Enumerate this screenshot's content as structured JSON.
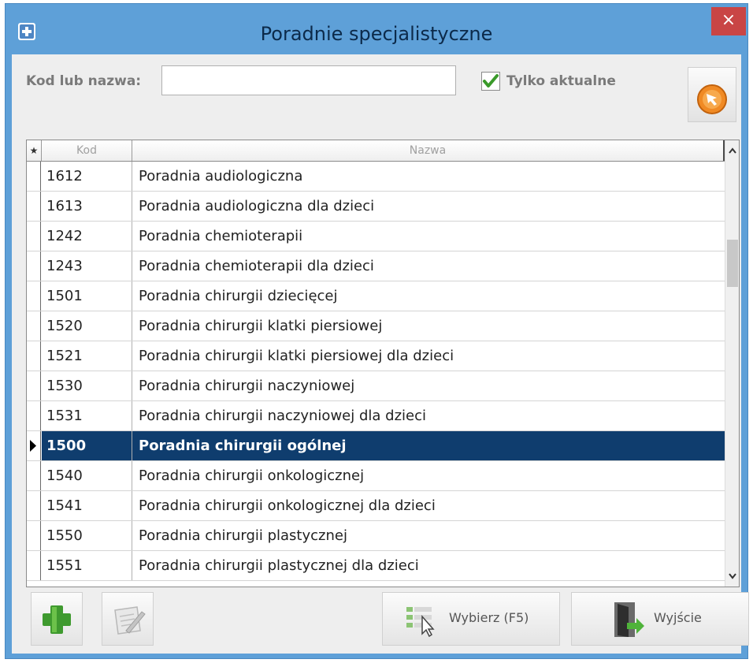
{
  "window": {
    "title": "Poradnie specjalistyczne",
    "close_glyph": "×"
  },
  "search": {
    "label": "Kod lub nazwa:",
    "value": "",
    "placeholder": ""
  },
  "filter": {
    "checkbox_label": "Tylko aktualne",
    "checked": true
  },
  "grid": {
    "header_star": "★",
    "columns": [
      "Kod",
      "Nazwa"
    ],
    "rows": [
      {
        "kod": "1612",
        "nazwa": "Poradnia audiologiczna"
      },
      {
        "kod": "1613",
        "nazwa": "Poradnia audiologiczna dla dzieci"
      },
      {
        "kod": "1242",
        "nazwa": "Poradnia chemioterapii"
      },
      {
        "kod": "1243",
        "nazwa": "Poradnia chemioterapii dla dzieci"
      },
      {
        "kod": "1501",
        "nazwa": "Poradnia chirurgii dziecięcej"
      },
      {
        "kod": "1520",
        "nazwa": "Poradnia chirurgii klatki piersiowej"
      },
      {
        "kod": "1521",
        "nazwa": "Poradnia chirurgii klatki piersiowej dla dzieci"
      },
      {
        "kod": "1530",
        "nazwa": "Poradnia chirurgii naczyniowej"
      },
      {
        "kod": "1531",
        "nazwa": "Poradnia chirurgii naczyniowej dla dzieci"
      },
      {
        "kod": "1500",
        "nazwa": "Poradnia chirurgii ogólnej"
      },
      {
        "kod": "1540",
        "nazwa": "Poradnia chirurgii onkologicznej"
      },
      {
        "kod": "1541",
        "nazwa": "Poradnia chirurgii onkologicznej dla dzieci"
      },
      {
        "kod": "1550",
        "nazwa": "Poradnia chirurgii plastycznej"
      },
      {
        "kod": "1551",
        "nazwa": "Poradnia chirurgii plastycznej dla dzieci"
      }
    ],
    "selected_index": 9
  },
  "buttons": {
    "select_label": "Wybierz (F5)",
    "exit_label": "Wyjście"
  },
  "colors": {
    "selection": "#0f3d6e",
    "title_bar": "#5ea0d8",
    "close": "#c94545",
    "add_green": "#3f9a2f"
  }
}
